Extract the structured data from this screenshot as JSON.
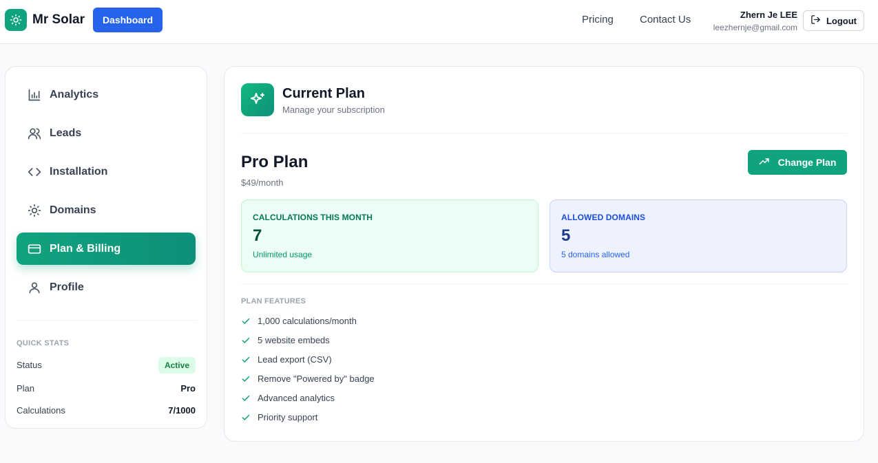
{
  "header": {
    "brand": "Mr Solar",
    "dashboard_label": "Dashboard",
    "nav": [
      "Pricing",
      "Contact Us"
    ],
    "user_name": "Zhern Je LEE",
    "user_email": "leezhernje@gmail.com",
    "logout_label": "Logout"
  },
  "sidebar": {
    "items": [
      {
        "label": "Analytics",
        "icon": "bar-chart-icon"
      },
      {
        "label": "Leads",
        "icon": "users-icon"
      },
      {
        "label": "Installation",
        "icon": "code-icon"
      },
      {
        "label": "Domains",
        "icon": "sun-icon"
      },
      {
        "label": "Plan & Billing",
        "icon": "credit-card-icon",
        "active": true
      },
      {
        "label": "Profile",
        "icon": "user-icon"
      }
    ],
    "quick_stats": {
      "heading": "QUICK STATS",
      "status_label": "Status",
      "status_value": "Active",
      "plan_label": "Plan",
      "plan_value": "Pro",
      "calc_label": "Calculations",
      "calc_value": "7/1000"
    }
  },
  "main": {
    "title": "Current Plan",
    "subtitle": "Manage your subscription",
    "plan_name": "Pro Plan",
    "plan_price": "$49/month",
    "change_plan_label": "Change Plan",
    "calc_card": {
      "label": "CALCULATIONS THIS MONTH",
      "value": "7",
      "note": "Unlimited usage"
    },
    "domains_card": {
      "label": "ALLOWED DOMAINS",
      "value": "5",
      "note": "5 domains allowed"
    },
    "features_heading": "PLAN FEATURES",
    "features": [
      "1,000 calculations/month",
      "5 website embeds",
      "Lead export (CSV)",
      "Remove \"Powered by\" badge",
      "Advanced analytics",
      "Priority support"
    ]
  },
  "colors": {
    "brand_green": "#10a37f",
    "primary_blue": "#2563eb",
    "background": "#f8fafc"
  }
}
